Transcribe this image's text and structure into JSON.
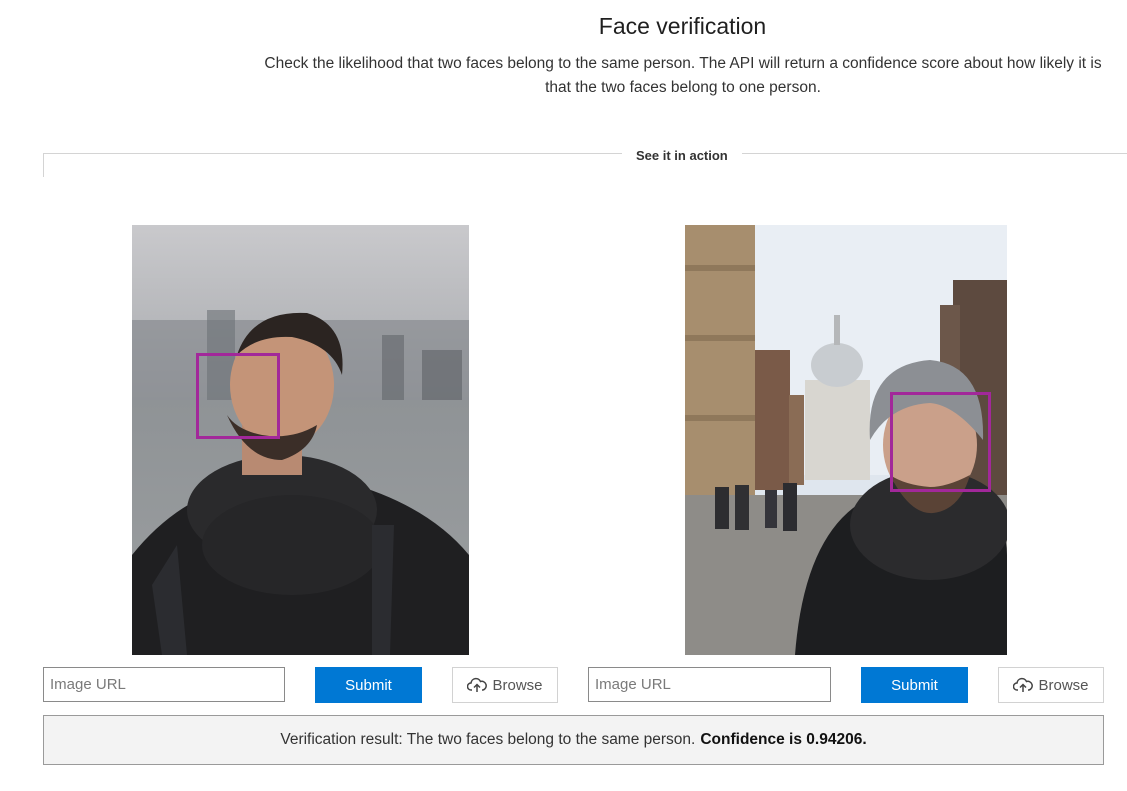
{
  "header": {
    "title": "Face verification",
    "description": "Check the likelihood that two faces belong to the same person. The API will return a confidence score about how likely it is that the two faces belong to one person."
  },
  "section": {
    "label": "See it in action"
  },
  "panels": [
    {
      "url_placeholder": "Image URL",
      "submit_label": "Submit",
      "browse_label": "Browse"
    },
    {
      "url_placeholder": "Image URL",
      "submit_label": "Submit",
      "browse_label": "Browse"
    }
  ],
  "result": {
    "text": "Verification result: The two faces belong to the same person.",
    "confidence": "Confidence is 0.94206."
  },
  "colors": {
    "accent": "#0078d4",
    "face_box": "#a2289a"
  },
  "icons": {
    "browse": "cloud-upload-icon"
  }
}
